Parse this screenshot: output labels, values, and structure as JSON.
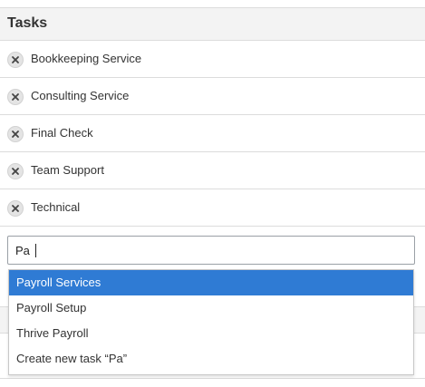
{
  "header": {
    "title": "Tasks"
  },
  "tasks": [
    {
      "label": "Bookkeeping Service"
    },
    {
      "label": "Consulting Service"
    },
    {
      "label": "Final Check"
    },
    {
      "label": "Team Support"
    },
    {
      "label": "Technical"
    }
  ],
  "search": {
    "value": "Pa",
    "placeholder": ""
  },
  "dropdown": {
    "options": [
      {
        "label": "Payroll Services",
        "highlighted": true
      },
      {
        "label": "Payroll Setup",
        "highlighted": false
      },
      {
        "label": "Thrive Payroll",
        "highlighted": false
      },
      {
        "label": "Create new task “Pa”",
        "highlighted": false
      }
    ]
  },
  "icons": {
    "remove": "close-icon"
  },
  "colors": {
    "highlight": "#2f7bd4",
    "header_bg": "#f3f3f3",
    "divider": "#dcdcdc"
  }
}
